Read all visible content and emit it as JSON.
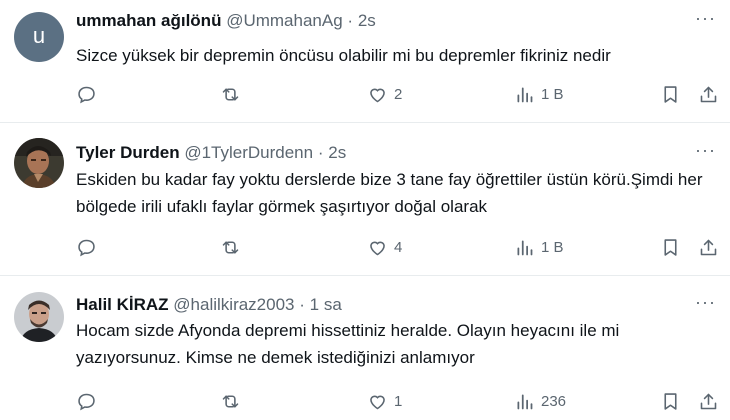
{
  "tweets": [
    {
      "name": "ummahan ağılönü",
      "handle": "@UmmahanAg",
      "sep": "·",
      "time": "2s",
      "avatar_letter": "u",
      "text": "Sizce yüksek bir depremin öncüsu olabilir mi bu depremler fikriniz nedir",
      "replies": "",
      "reposts": "",
      "likes": "2",
      "views": "1 B"
    },
    {
      "name": "Tyler Durden",
      "handle": "@1TylerDurdenn",
      "sep": "·",
      "time": "2s",
      "text": "Eskiden bu kadar fay yoktu derslerde bize 3 tane fay öğrettiler üstün körü.Şimdi her bölgede irili ufaklı faylar görmek şaşırtıyor doğal olarak",
      "replies": "",
      "reposts": "",
      "likes": "4",
      "views": "1 B"
    },
    {
      "name": "Halil KİRAZ",
      "handle": "@halilkiraz2003",
      "sep": "·",
      "time": "1 sa",
      "text": "Hocam sizde Afyonda depremi hissettiniz heralde. Olayın heyacını ile mi yazıyorsunuz. Kimse ne demek istediğinizi anlamıyor",
      "replies": "",
      "reposts": "",
      "likes": "1",
      "views": "236"
    }
  ],
  "icons": {
    "more": "more-horizontal-icon",
    "reply": "reply-bubble-icon",
    "repost": "repost-arrows-icon",
    "like": "heart-icon",
    "views": "bar-chart-icon",
    "bookmark": "bookmark-icon",
    "share": "share-upload-icon"
  },
  "colors": {
    "text": "#0f1419",
    "muted": "#5b6670",
    "divider": "#e8ecee",
    "avatar_default": "#5b7083"
  }
}
